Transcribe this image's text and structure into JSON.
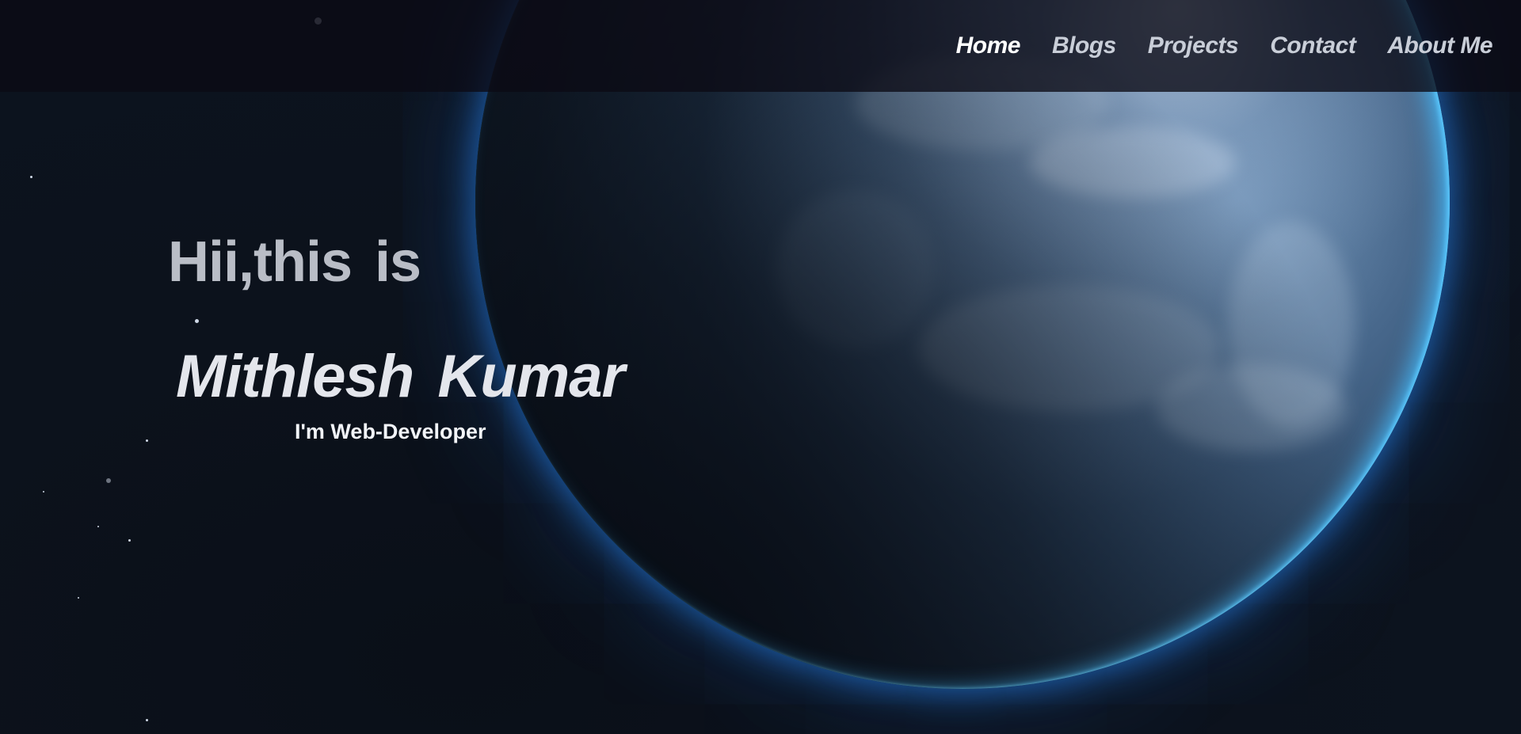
{
  "nav": {
    "items": [
      {
        "label": "Home"
      },
      {
        "label": "Blogs"
      },
      {
        "label": "Projects"
      },
      {
        "label": "Contact"
      },
      {
        "label": "About Me"
      }
    ]
  },
  "hero": {
    "greeting": "Hii,this is",
    "name": "Mithlesh Kumar",
    "role": "I'm Web-Developer"
  },
  "colors": {
    "nav_background": "#0c0a14",
    "nav_text": "#c9ced8",
    "heading_text": "#b9bdc6",
    "name_text": "#e4e6ec",
    "atmosphere_glow": "#28a0ff"
  }
}
